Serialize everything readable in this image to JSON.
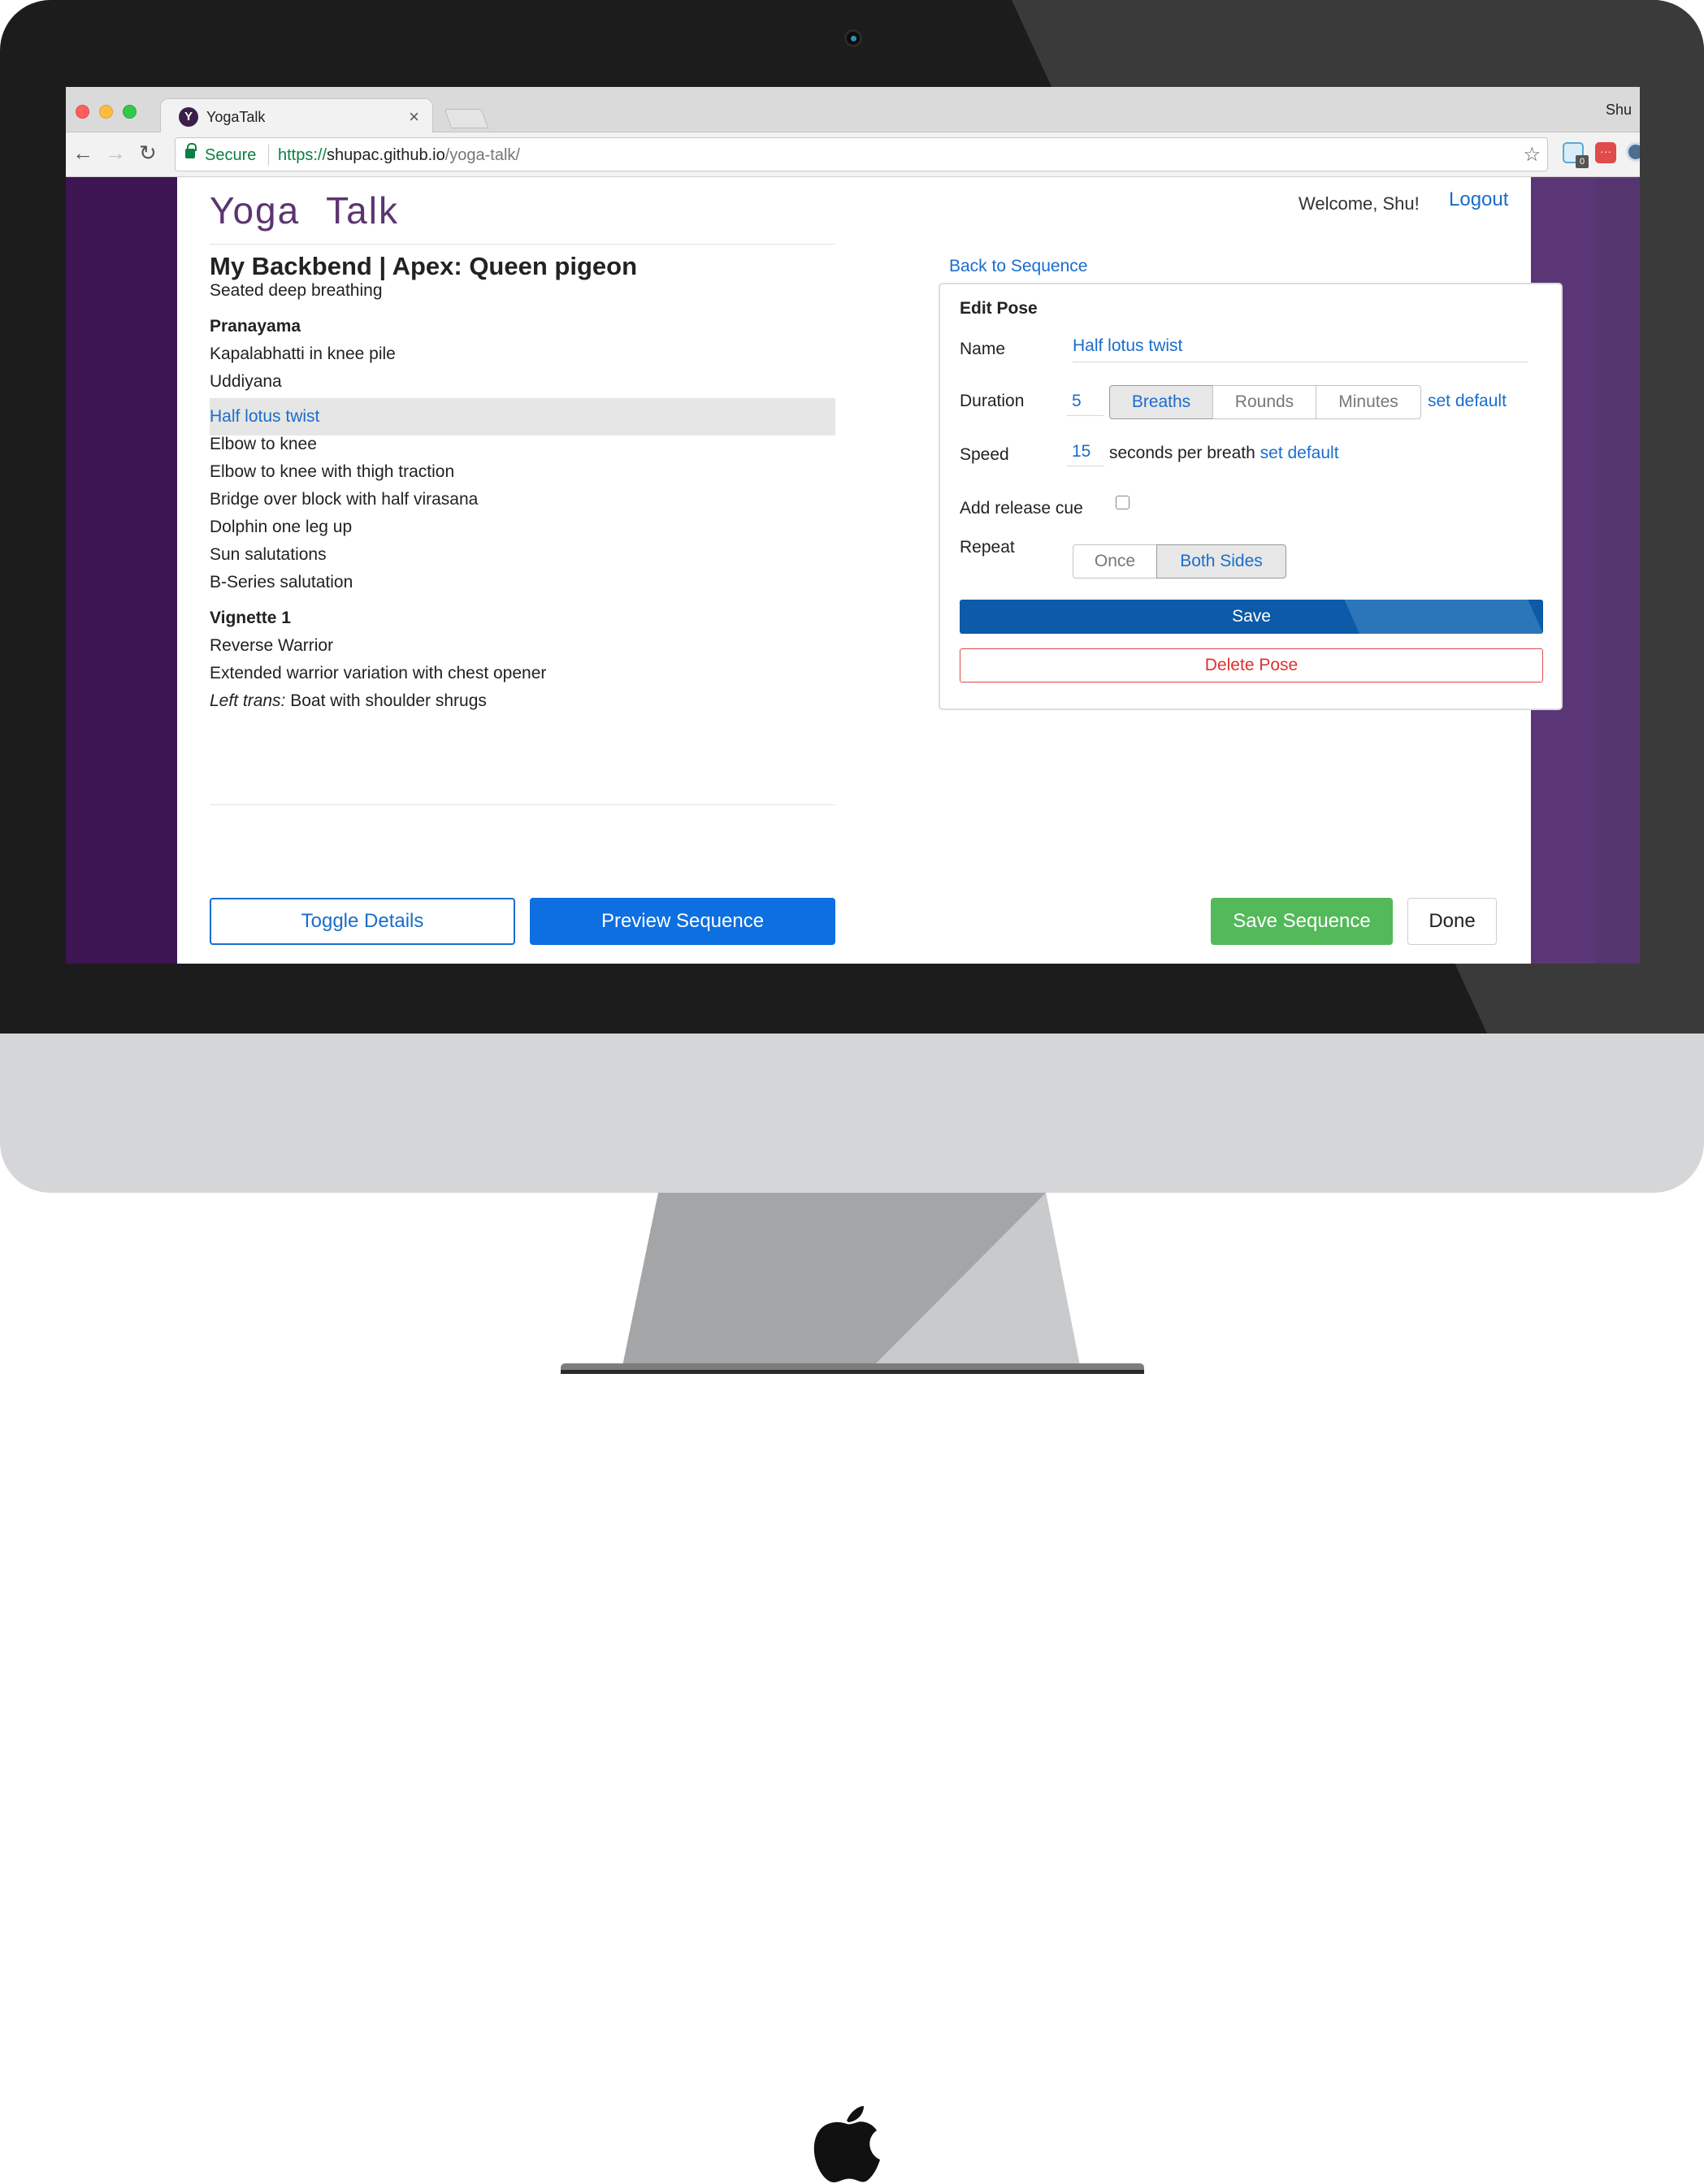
{
  "browser": {
    "tab_title": "YogaTalk",
    "tab_close": "×",
    "favicon": "Y",
    "profile_name": "Shu",
    "secure_label": "Secure",
    "url_scheme": "https://",
    "url_host": "shupac.github.io",
    "url_path": "/yoga-talk/",
    "icons": [
      "back-arrow-icon",
      "forward-arrow-icon",
      "reload-icon",
      "lock-icon",
      "star-icon",
      "extension-icons"
    ],
    "ext_badge": "0",
    "ext_2_glyph": "···"
  },
  "header": {
    "logo": "Yoga Talk",
    "welcome": "Welcome, Shu!",
    "logout": "Logout"
  },
  "sequence": {
    "title": "My Backbend | Apex: Queen pigeon",
    "items": [
      {
        "text": "Seated deep breathing"
      },
      {
        "text": "Pranayama",
        "heading": true
      },
      {
        "text": "Kapalabhatti in knee pile"
      },
      {
        "text": "Uddiyana"
      },
      {
        "text": "Half lotus twist",
        "selected": true
      },
      {
        "text": "Elbow to knee"
      },
      {
        "text": "Elbow to knee with thigh traction"
      },
      {
        "text": "Bridge over block with half virasana"
      },
      {
        "text": "Dolphin one leg up"
      },
      {
        "text": "Sun salutations"
      },
      {
        "text": "B-Series salutation"
      },
      {
        "text": "Vignette 1",
        "heading": true
      },
      {
        "text": "Reverse Warrior"
      },
      {
        "text": "Extended warrior variation with chest opener"
      },
      {
        "prefix": "Left trans:",
        "text": "Boat with shoulder shrugs"
      }
    ]
  },
  "footer": {
    "toggle_details": "Toggle Details",
    "preview_sequence": "Preview Sequence",
    "save_sequence": "Save Sequence",
    "done": "Done"
  },
  "edit_pose": {
    "back_link": "Back to Sequence",
    "title": "Edit Pose",
    "name_label": "Name",
    "name_value": "Half lotus twist",
    "duration_label": "Duration",
    "duration_value": "5",
    "duration_options": [
      "Breaths",
      "Rounds",
      "Minutes"
    ],
    "duration_selected": "Breaths",
    "set_default": "set default",
    "speed_label": "Speed",
    "speed_value": "15",
    "speed_suffix": "seconds per breath",
    "release_cue_label": "Add release cue",
    "release_cue_checked": false,
    "repeat_label": "Repeat",
    "repeat_options": [
      "Once",
      "Both Sides"
    ],
    "repeat_selected": "Both Sides",
    "save": "Save",
    "delete": "Delete Pose"
  },
  "colors": {
    "link_blue": "#1a6dcb",
    "brand_purple": "#5b3572",
    "save_green": "#54b95a",
    "delete_red": "#dc3030"
  }
}
